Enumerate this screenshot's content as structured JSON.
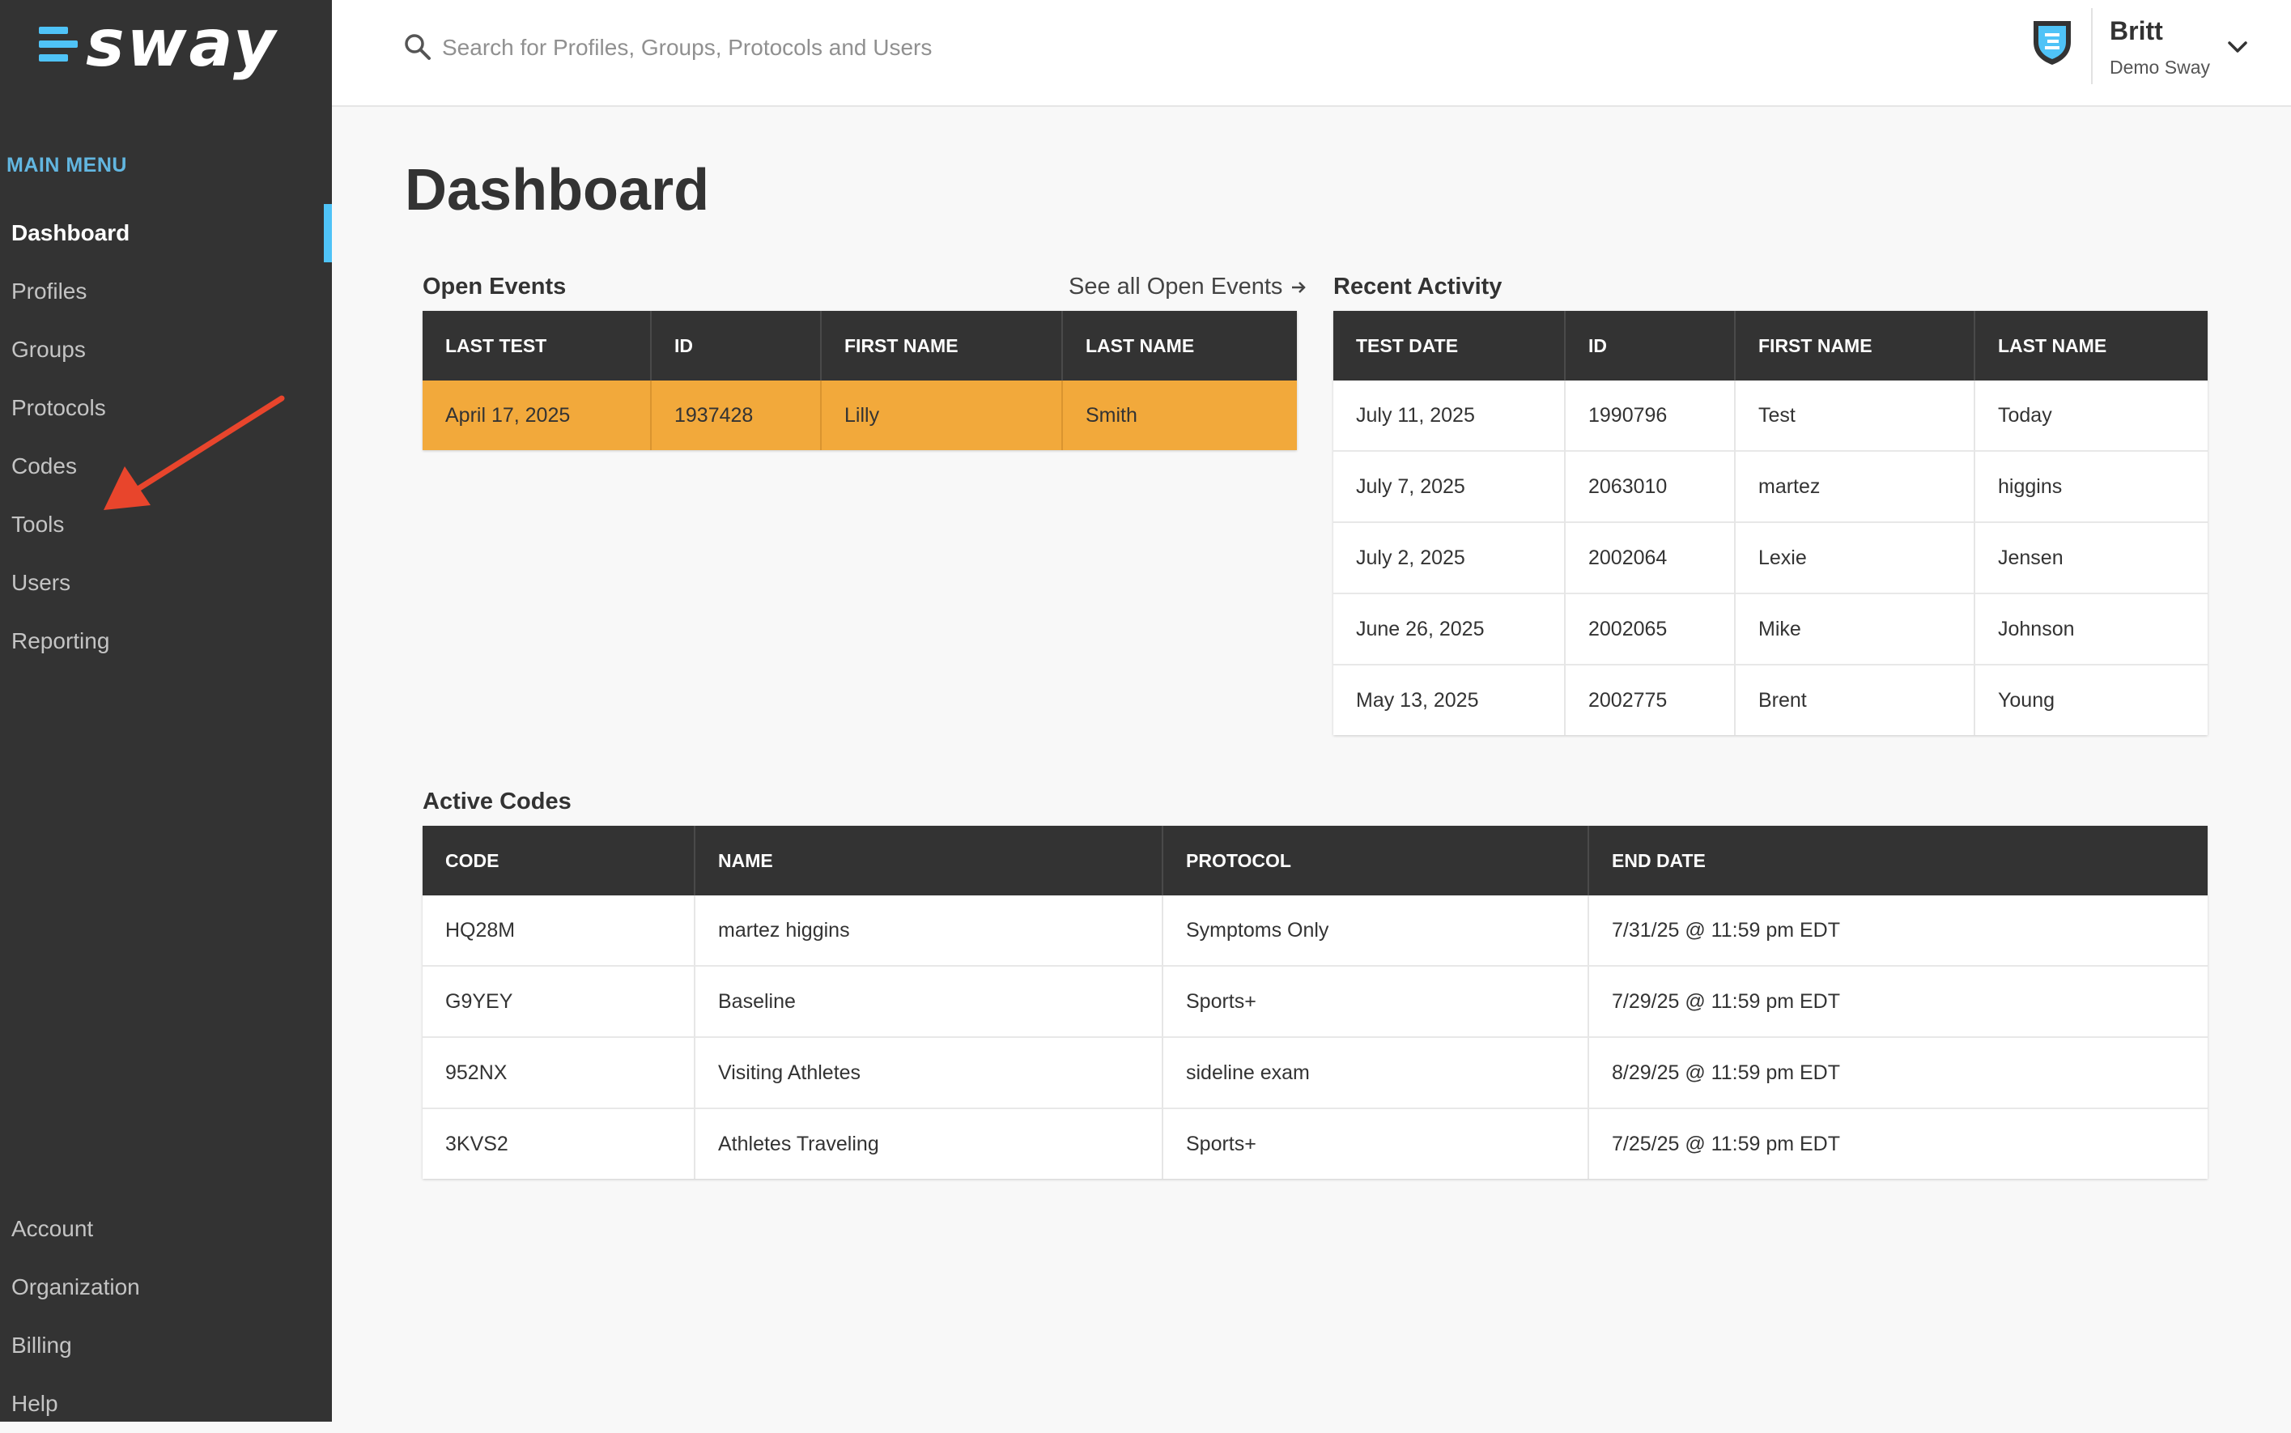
{
  "brand": {
    "logo_text": "sway",
    "accent": "#4fc3f7"
  },
  "sidebar": {
    "heading": "MAIN MENU",
    "items": [
      {
        "label": "Dashboard",
        "active": true
      },
      {
        "label": "Profiles"
      },
      {
        "label": "Groups"
      },
      {
        "label": "Protocols"
      },
      {
        "label": "Codes"
      },
      {
        "label": "Tools"
      },
      {
        "label": "Users"
      },
      {
        "label": "Reporting"
      }
    ],
    "bottom_items": [
      {
        "label": "Account"
      },
      {
        "label": "Organization"
      },
      {
        "label": "Billing"
      },
      {
        "label": "Help"
      }
    ]
  },
  "search": {
    "placeholder": "Search for Profiles, Groups, Protocols and Users"
  },
  "user": {
    "name": "Britt",
    "org": "Demo Sway"
  },
  "page": {
    "title": "Dashboard"
  },
  "open_events": {
    "title": "Open Events",
    "see_all": "See all Open Events",
    "columns": [
      "LAST TEST",
      "ID",
      "FIRST NAME",
      "LAST NAME"
    ],
    "rows": [
      [
        "April 17, 2025",
        "1937428",
        "Lilly",
        "Smith"
      ]
    ],
    "highlight_color": "#f2a93b"
  },
  "recent_activity": {
    "title": "Recent Activity",
    "columns": [
      "TEST DATE",
      "ID",
      "FIRST NAME",
      "LAST NAME"
    ],
    "rows": [
      [
        "July 11, 2025",
        "1990796",
        "Test",
        "Today"
      ],
      [
        "July 7, 2025",
        "2063010",
        "martez",
        "higgins"
      ],
      [
        "July 2, 2025",
        "2002064",
        "Lexie",
        "Jensen"
      ],
      [
        "June 26, 2025",
        "2002065",
        "Mike",
        "Johnson"
      ],
      [
        "May 13, 2025",
        "2002775",
        "Brent",
        "Young"
      ]
    ]
  },
  "active_codes": {
    "title": "Active Codes",
    "columns": [
      "CODE",
      "NAME",
      "PROTOCOL",
      "END DATE"
    ],
    "rows": [
      [
        "HQ28M",
        "martez higgins",
        "Symptoms Only",
        "7/31/25 @ 11:59 pm EDT"
      ],
      [
        "G9YEY",
        "Baseline",
        "Sports+",
        "7/29/25 @ 11:59 pm EDT"
      ],
      [
        "952NX",
        "Visiting Athletes",
        "sideline exam",
        "8/29/25 @ 11:59 pm EDT"
      ],
      [
        "3KVS2",
        "Athletes Traveling",
        "Sports+",
        "7/25/25 @ 11:59 pm EDT"
      ]
    ]
  },
  "annotation": {
    "arrow_color": "#e8452c"
  }
}
